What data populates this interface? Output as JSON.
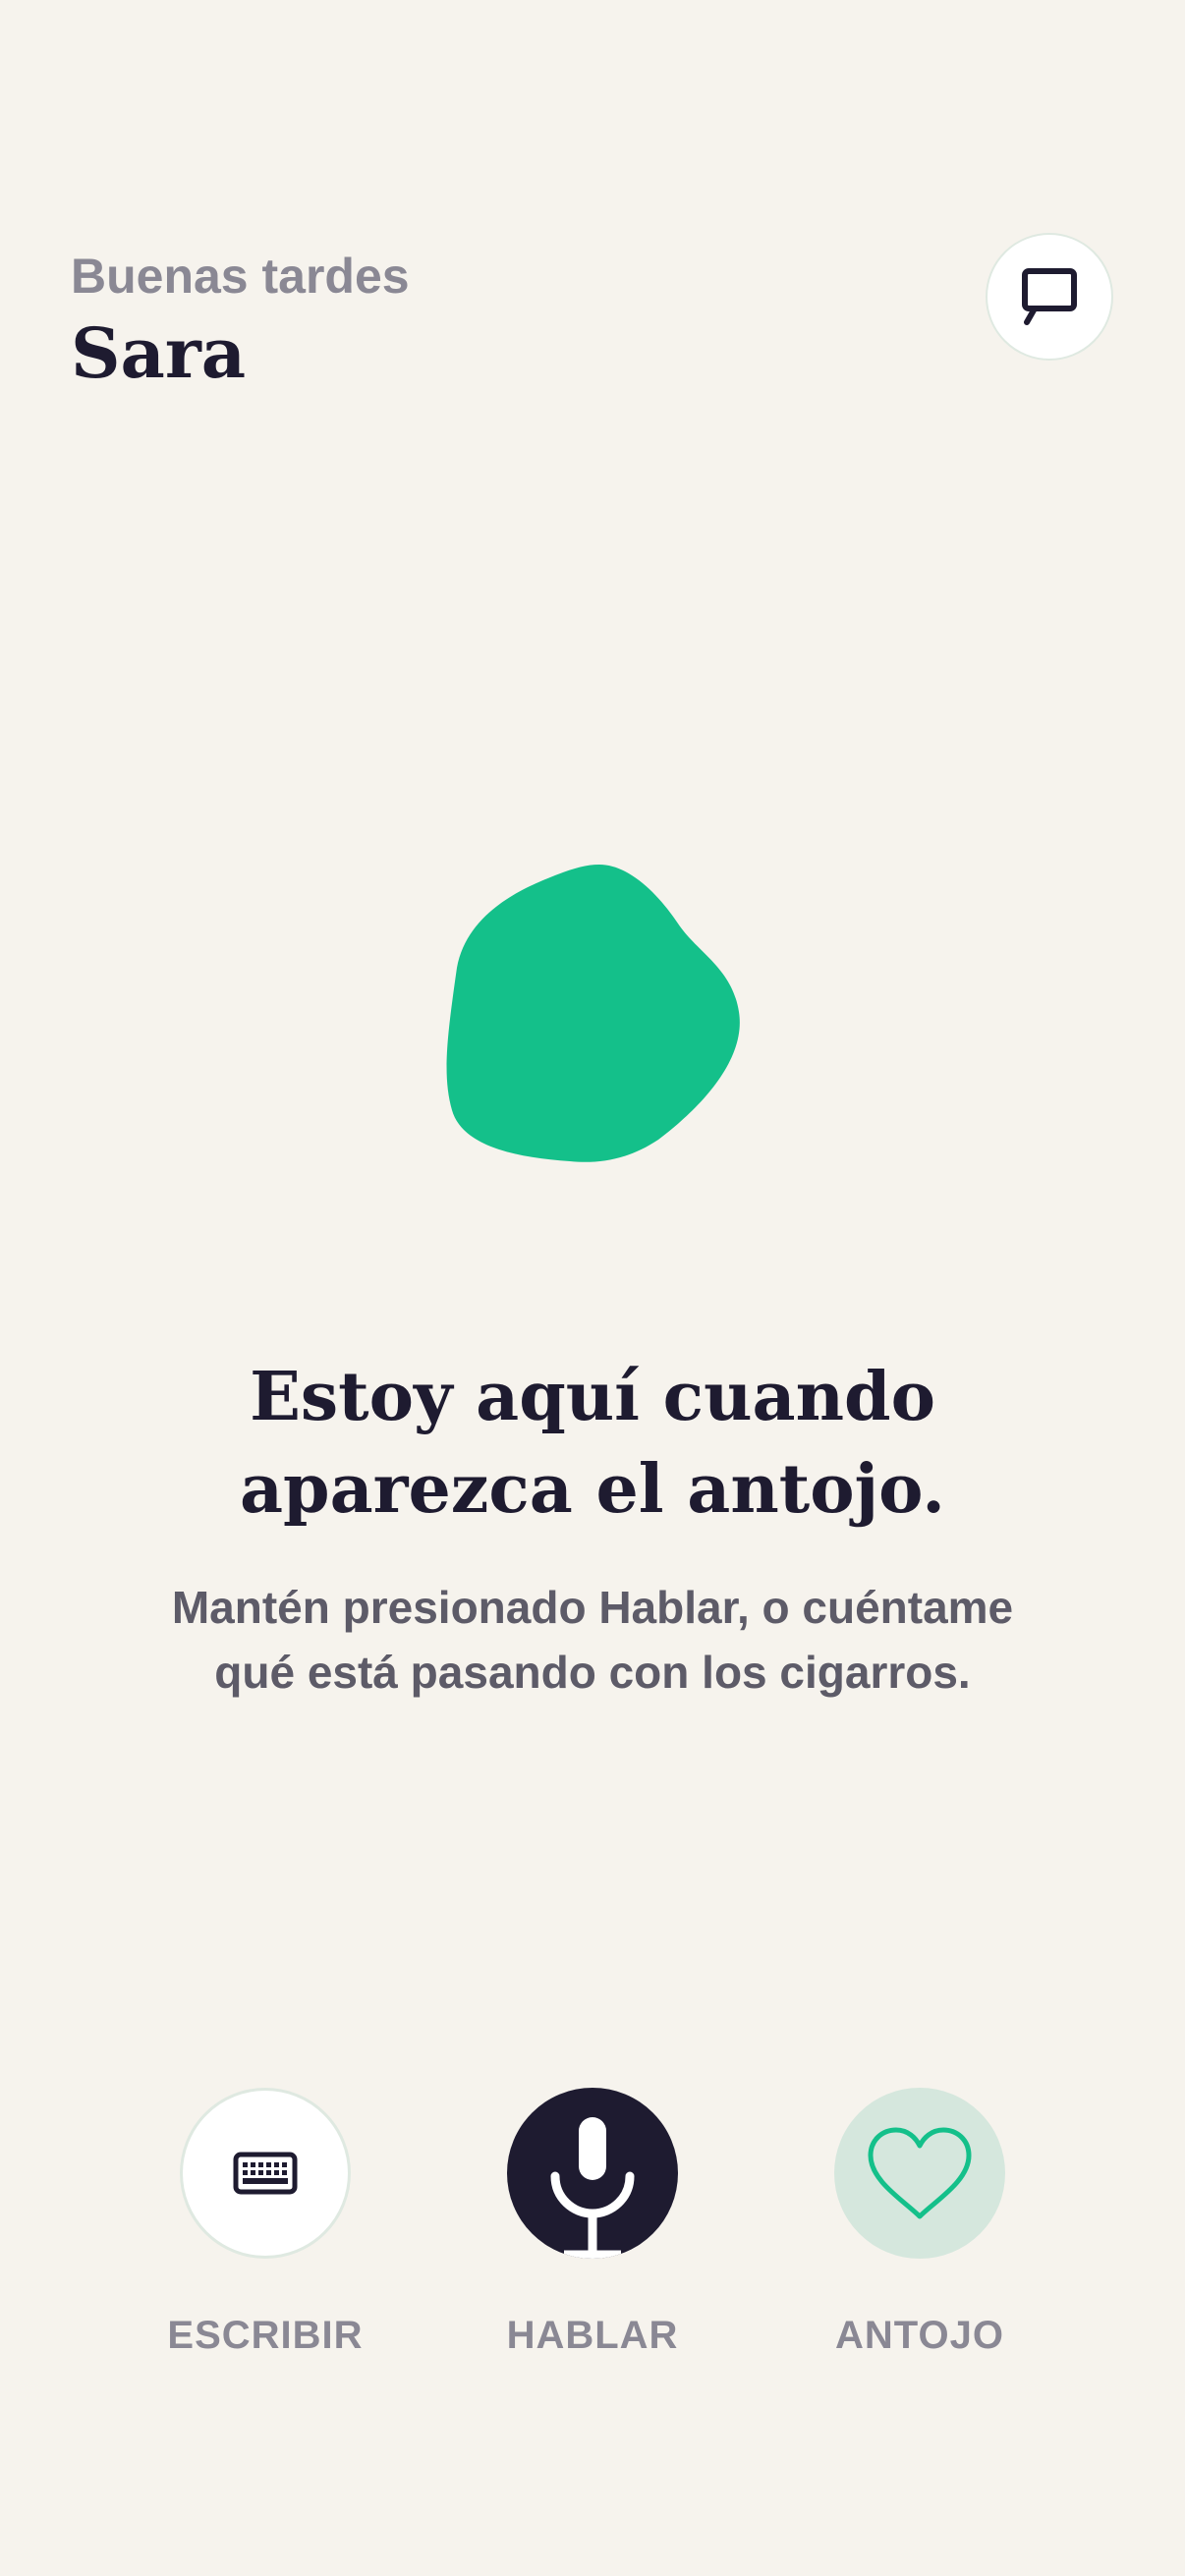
{
  "header": {
    "greeting": "Buenas tardes",
    "user_name": "Sara",
    "chat_icon": "chat-bubble-icon"
  },
  "hero": {
    "blob_color": "#14c08a",
    "headline_line1": "Estoy aquí cuando",
    "headline_line2": "aparezca el antojo.",
    "subtext": "Mantén presionado Hablar, o cuéntame qué está pasando con los cigarros."
  },
  "actions": [
    {
      "label": "ESCRIBIR",
      "icon": "keyboard-icon"
    },
    {
      "label": "HABLAR",
      "icon": "microphone-icon"
    },
    {
      "label": "ANTOJO",
      "icon": "heart-icon"
    }
  ],
  "colors": {
    "background": "#f6f3ed",
    "accent": "#14c08a",
    "dark": "#1e1b30",
    "muted": "#8a8894"
  }
}
